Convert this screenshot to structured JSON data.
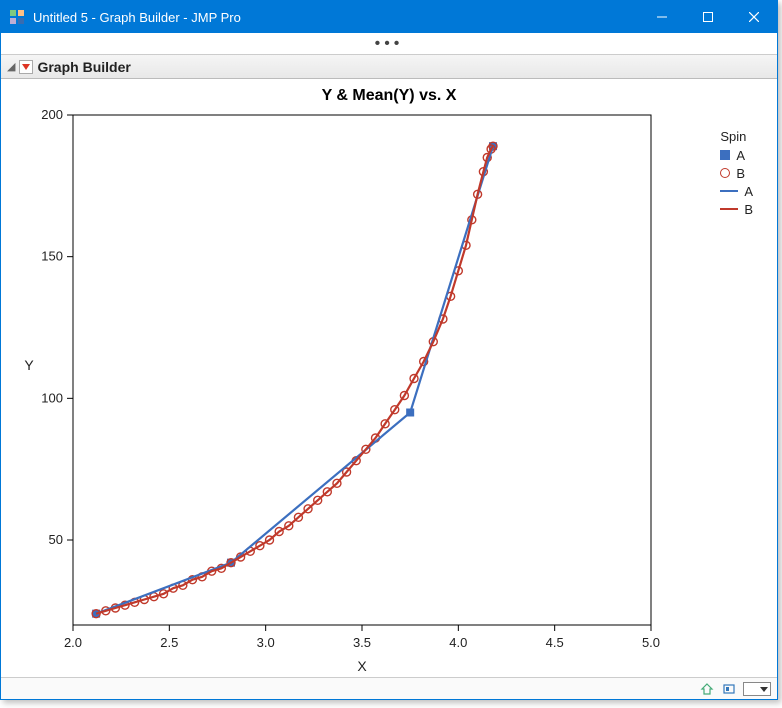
{
  "window": {
    "title": "Untitled 5 - Graph Builder - JMP Pro"
  },
  "panel": {
    "title": "Graph Builder"
  },
  "legend": {
    "title": "Spin",
    "items": [
      {
        "label": "A",
        "type": "square",
        "color": "#3c6fbf"
      },
      {
        "label": "B",
        "type": "circle",
        "color": "#c0392b"
      },
      {
        "label": "A",
        "type": "line",
        "color": "#3c6fbf"
      },
      {
        "label": "B",
        "type": "line",
        "color": "#c0392b"
      }
    ]
  },
  "chart_data": {
    "type": "line",
    "title": "Y & Mean(Y) vs. X",
    "xlabel": "X",
    "ylabel": "Y",
    "xlim": [
      2.0,
      5.0
    ],
    "ylim": [
      20,
      200
    ],
    "xticks": [
      2.0,
      2.5,
      3.0,
      3.5,
      4.0,
      4.5,
      5.0
    ],
    "yticks": [
      50,
      100,
      150,
      200
    ],
    "series": [
      {
        "name": "A (points)",
        "marker": "filled-square",
        "color": "#3c6fbf",
        "x": [
          2.12,
          2.82,
          3.75,
          4.18
        ],
        "y": [
          24,
          42,
          95,
          189
        ]
      },
      {
        "name": "B (points)",
        "marker": "open-circle",
        "color": "#c0392b",
        "x": [
          2.12,
          2.17,
          2.22,
          2.27,
          2.32,
          2.37,
          2.42,
          2.47,
          2.52,
          2.57,
          2.62,
          2.67,
          2.72,
          2.77,
          2.82,
          2.87,
          2.92,
          2.97,
          3.02,
          3.07,
          3.12,
          3.17,
          3.22,
          3.27,
          3.32,
          3.37,
          3.42,
          3.47,
          3.52,
          3.57,
          3.62,
          3.67,
          3.72,
          3.77,
          3.82,
          3.87,
          3.92,
          3.96,
          4.0,
          4.04,
          4.07,
          4.1,
          4.13,
          4.15,
          4.17,
          4.18
        ],
        "y": [
          24,
          25,
          26,
          27,
          28,
          29,
          30,
          31,
          33,
          34,
          36,
          37,
          39,
          40,
          42,
          44,
          46,
          48,
          50,
          53,
          55,
          58,
          61,
          64,
          67,
          70,
          74,
          78,
          82,
          86,
          91,
          96,
          101,
          107,
          113,
          120,
          128,
          136,
          145,
          154,
          163,
          172,
          180,
          185,
          188,
          189
        ]
      },
      {
        "name": "A (line)",
        "marker": "line",
        "color": "#3c6fbf",
        "x": [
          2.12,
          2.82,
          3.75,
          4.18
        ],
        "y": [
          24,
          42,
          95,
          189
        ]
      },
      {
        "name": "B (line)",
        "marker": "line",
        "color": "#c0392b",
        "x": [
          2.12,
          2.17,
          2.22,
          2.27,
          2.32,
          2.37,
          2.42,
          2.47,
          2.52,
          2.57,
          2.62,
          2.67,
          2.72,
          2.77,
          2.82,
          2.87,
          2.92,
          2.97,
          3.02,
          3.07,
          3.12,
          3.17,
          3.22,
          3.27,
          3.32,
          3.37,
          3.42,
          3.47,
          3.52,
          3.57,
          3.62,
          3.67,
          3.72,
          3.77,
          3.82,
          3.87,
          3.92,
          3.96,
          4.0,
          4.04,
          4.07,
          4.1,
          4.13,
          4.15,
          4.17,
          4.18
        ],
        "y": [
          24,
          25,
          26,
          27,
          28,
          29,
          30,
          31,
          33,
          34,
          36,
          37,
          39,
          40,
          42,
          44,
          46,
          48,
          50,
          53,
          55,
          58,
          61,
          64,
          67,
          70,
          74,
          78,
          82,
          86,
          91,
          96,
          101,
          107,
          113,
          120,
          128,
          136,
          145,
          154,
          163,
          172,
          180,
          185,
          188,
          189
        ]
      }
    ]
  }
}
